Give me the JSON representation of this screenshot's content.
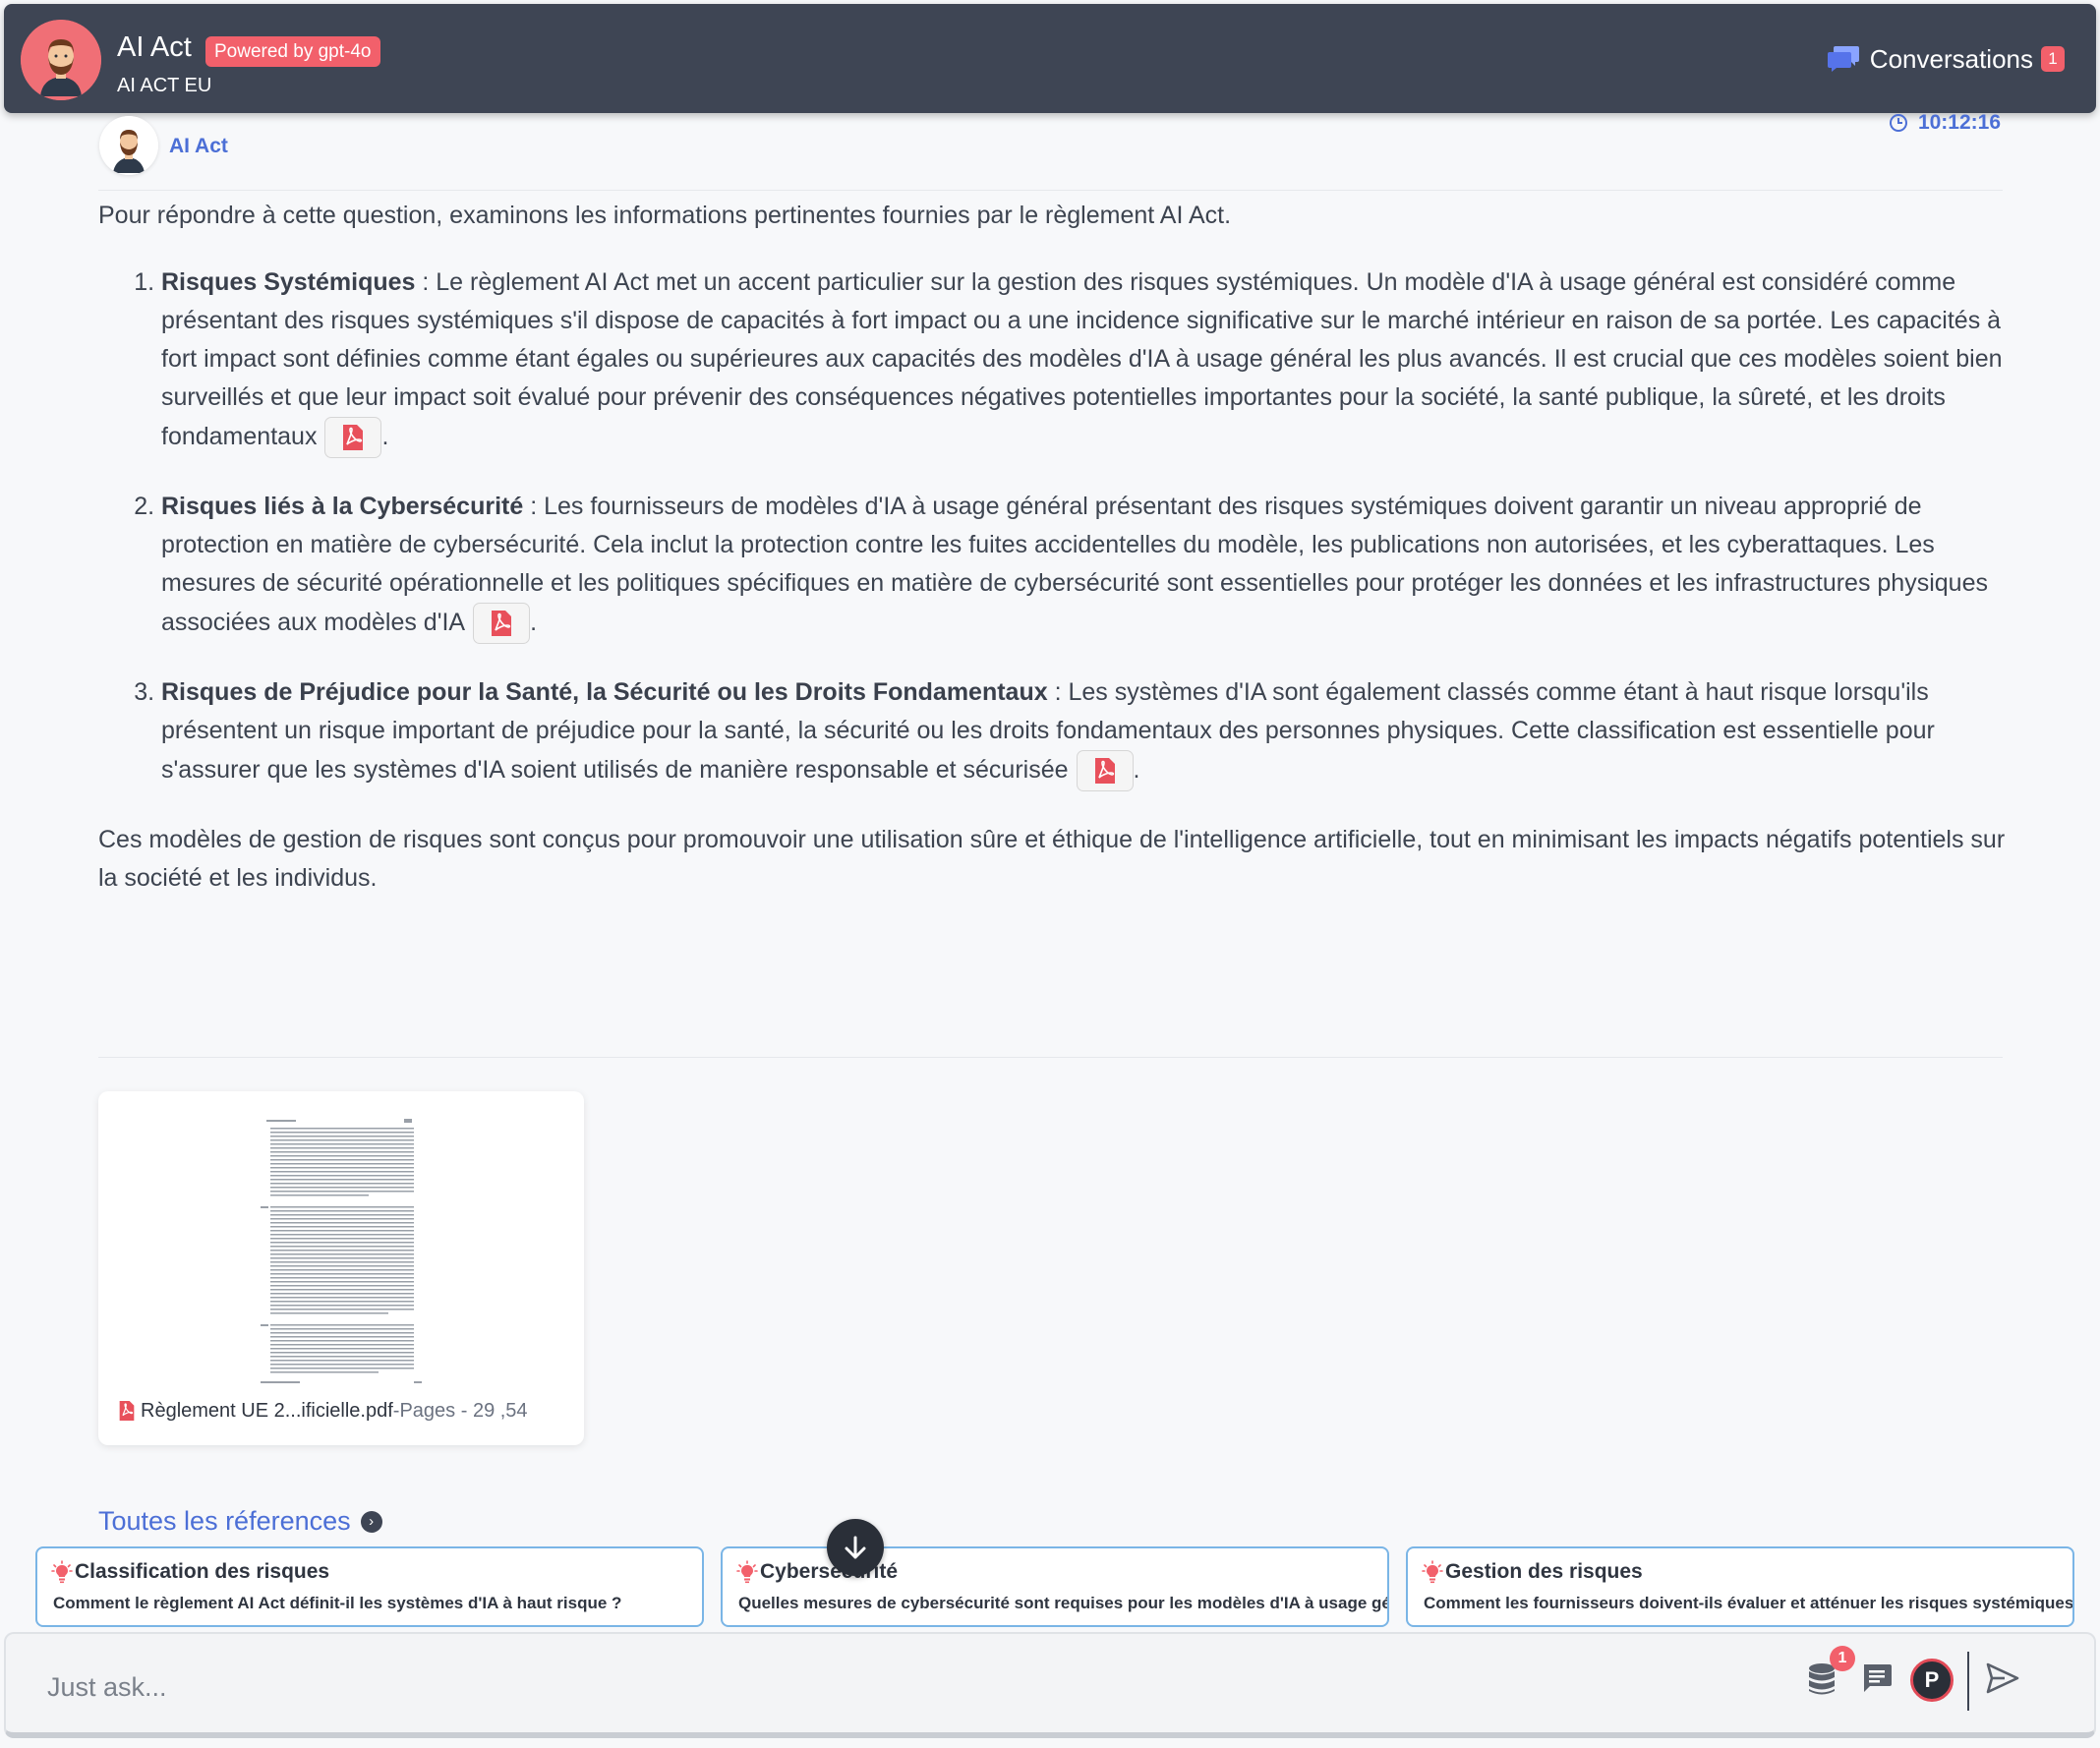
{
  "header": {
    "title": "AI Act",
    "powered_badge": "Powered by gpt-4o",
    "subtitle": "AI ACT EU",
    "conversations_label": "Conversations",
    "conversations_count": "1"
  },
  "message": {
    "author": "AI Act",
    "time": "10:12:16",
    "intro": "Pour répondre à cette question, examinons les informations pertinentes fournies par le règlement AI Act.",
    "items": [
      {
        "title": "Risques Systémiques",
        "text": " : Le règlement AI Act met un accent particulier sur la gestion des risques systémiques. Un modèle d'IA à usage général est considéré comme présentant des risques systémiques s'il dispose de capacités à fort impact ou a une incidence significative sur le marché intérieur en raison de sa portée. Les capacités à fort impact sont définies comme étant égales ou supérieures aux capacités des modèles d'IA à usage général les plus avancés. Il est crucial que ces modèles soient bien surveillés et que leur impact soit évalué pour prévenir des conséquences négatives potentielles importantes pour la société, la santé publique, la sûreté, et les droits fondamentaux",
        "end": "."
      },
      {
        "title": "Risques liés à la Cybersécurité",
        "text": " : Les fournisseurs de modèles d'IA à usage général présentant des risques systémiques doivent garantir un niveau approprié de protection en matière de cybersécurité. Cela inclut la protection contre les fuites accidentelles du modèle, les publications non autorisées, et les cyberattaques. Les mesures de sécurité opérationnelle et les politiques spécifiques en matière de cybersécurité sont essentielles pour protéger les données et les infrastructures physiques associées aux modèles d'IA",
        "end": "."
      },
      {
        "title": "Risques de Préjudice pour la Santé, la Sécurité ou les Droits Fondamentaux",
        "text": " : Les systèmes d'IA sont également classés comme étant à haut risque lorsqu'ils présentent un risque important de préjudice pour la santé, la sécurité ou les droits fondamentaux des personnes physiques. Cette classification est essentielle pour s'assurer que les systèmes d'IA soient utilisés de manière responsable et sécurisée",
        "end": "."
      }
    ],
    "conclusion": "Ces modèles de gestion de risques sont conçus pour promouvoir une utilisation sûre et éthique de l'intelligence artificielle, tout en minimisant les impacts négatifs potentiels sur la société et les individus."
  },
  "document": {
    "name": "Règlement UE 2...ificielle.pdf",
    "pages": "-Pages - 29 ,54"
  },
  "references_link": "Toutes les réferences",
  "suggestions": [
    {
      "title": "Classification des risques",
      "question": "Comment le règlement AI Act définit-il les systèmes d'IA à haut risque ?"
    },
    {
      "title": "Cybersécurité",
      "question": "Quelles mesures de cybersécurité sont requises pour les modèles d'IA à usage général ?"
    },
    {
      "title": "Gestion des risques",
      "question": "Comment les fournisseurs doivent-ils évaluer et atténuer les risques systémiques ?"
    }
  ],
  "input": {
    "placeholder": "Just ask...",
    "db_badge": "1",
    "profile_letter": "P"
  },
  "icons": {
    "conversations": "chat-bubbles-icon",
    "clock": "clock-icon",
    "pdf": "pdf-icon",
    "arrow_down": "arrow-down-icon",
    "bulb": "lightbulb-icon",
    "database": "database-icon",
    "message": "message-icon",
    "send": "send-icon"
  },
  "colors": {
    "header_bg": "#3e4554",
    "accent": "#4c6fd6",
    "badge": "#f2606b",
    "suggestion_border": "#7ab5e6"
  }
}
